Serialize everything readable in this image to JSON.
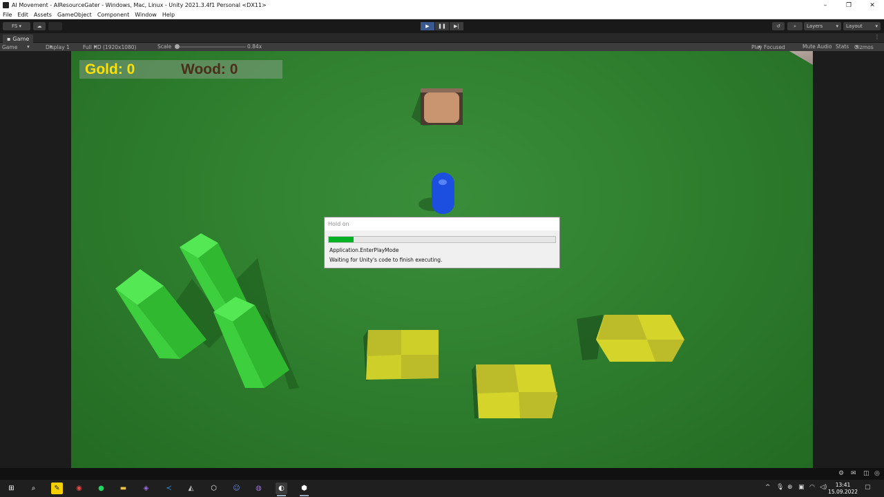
{
  "window": {
    "title": "AI Movement - AIResourceGater - Windows, Mac, Linux - Unity 2021.3.4f1 Personal <DX11>",
    "controls": [
      "–",
      "❐",
      "✕"
    ]
  },
  "menu": [
    "File",
    "Edit",
    "Assets",
    "GameObject",
    "Component",
    "Window",
    "Help"
  ],
  "toolbar": {
    "account": "FS",
    "layers": "Layers",
    "layout": "Layout"
  },
  "tab": {
    "label": "Game"
  },
  "gamebar": {
    "mode": "Game",
    "display": "Display 1",
    "resolution": "Full HD (1920x1080)",
    "scale_label": "Scale",
    "scale_value": "0.84x",
    "play_focused": "Play Focused",
    "mute": "Mute Audio",
    "stats": "Stats",
    "gizmos": "Gizmos"
  },
  "hud": {
    "gold": "Gold: 0",
    "wood": "Wood: 0"
  },
  "dialog": {
    "title": "Hold on",
    "progress": 0.11,
    "step": "Application.EnterPlayMode",
    "message": "Waiting for Unity's code to finish executing."
  },
  "taskbar": {
    "time": "13:41",
    "date": "15.09.2022"
  },
  "colors": {
    "ground": "#2f7f2f",
    "gold_text": "#ffe000",
    "wood_text": "#4a2e1a",
    "progress": "#06b025",
    "tree": "#3ecf3e",
    "gold_block": "#d4d42a",
    "agent": "#1c4fe0"
  }
}
